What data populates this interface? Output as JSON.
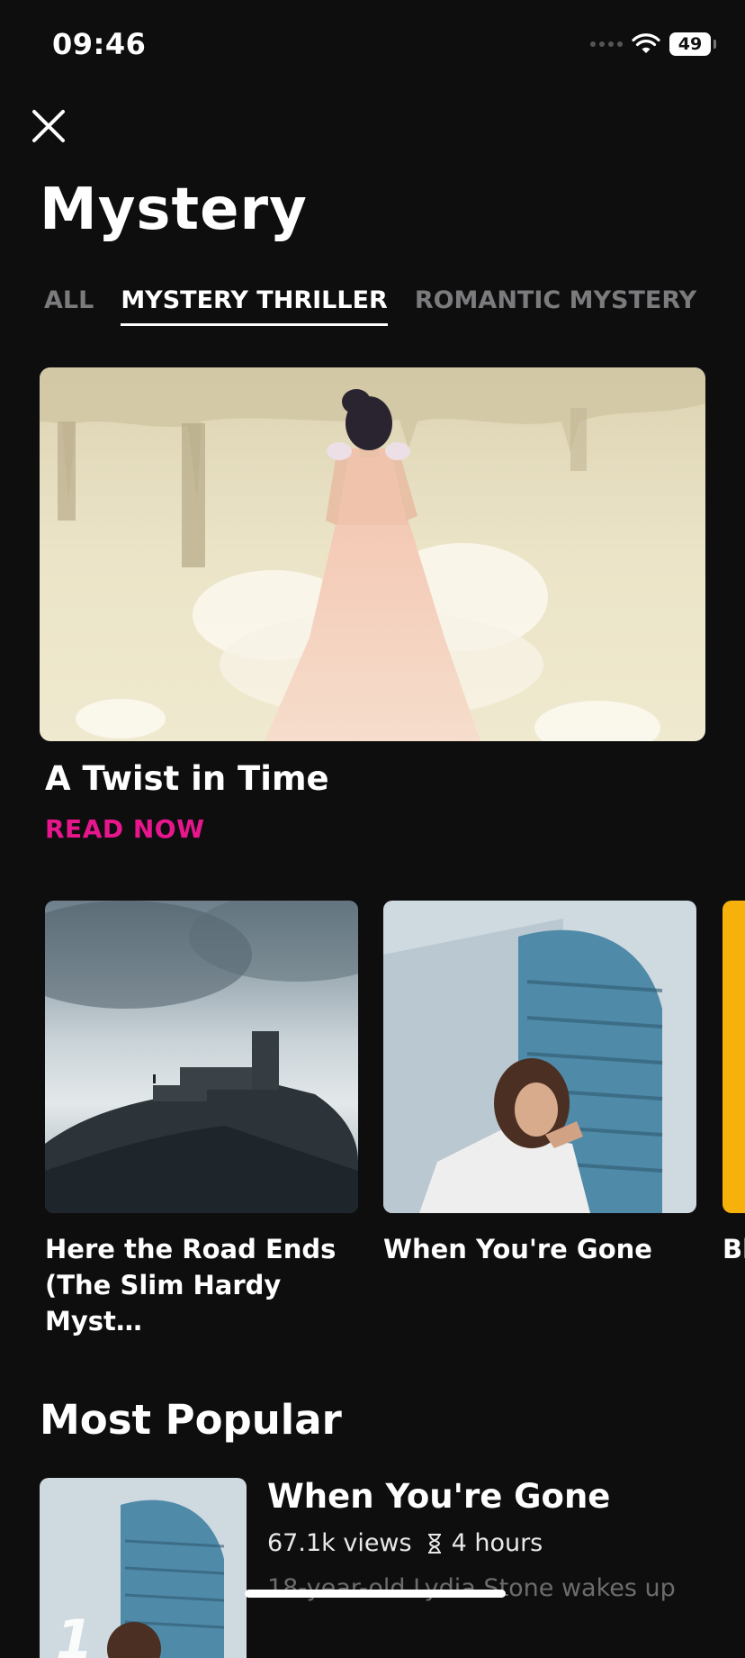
{
  "status_bar": {
    "time": "09:46",
    "battery": "49"
  },
  "header": {
    "title": "Mystery"
  },
  "tabs": [
    {
      "label": "ALL"
    },
    {
      "label": "MYSTERY THRILLER"
    },
    {
      "label": "ROMANTIC MYSTERY"
    }
  ],
  "featured": {
    "title": "A Twist in Time",
    "cta": "READ NOW"
  },
  "carousel": [
    {
      "title": "Here the Road Ends (The Slim Hardy Myst…"
    },
    {
      "title": "When You're Gone"
    },
    {
      "title": "Bl"
    }
  ],
  "most_popular": {
    "heading": "Most Popular",
    "items": [
      {
        "title": "When You're Gone",
        "views": "67.1k views",
        "duration": "4 hours",
        "description": "18-year-old Lydia Stone wakes up"
      }
    ]
  },
  "colors": {
    "accent": "#e8168d",
    "background": "#0e0e0f",
    "inactive_tab": "#7b7b7d"
  },
  "icons": [
    "close-icon",
    "wifi-icon",
    "signal-icon",
    "battery-icon",
    "hourglass-icon"
  ]
}
